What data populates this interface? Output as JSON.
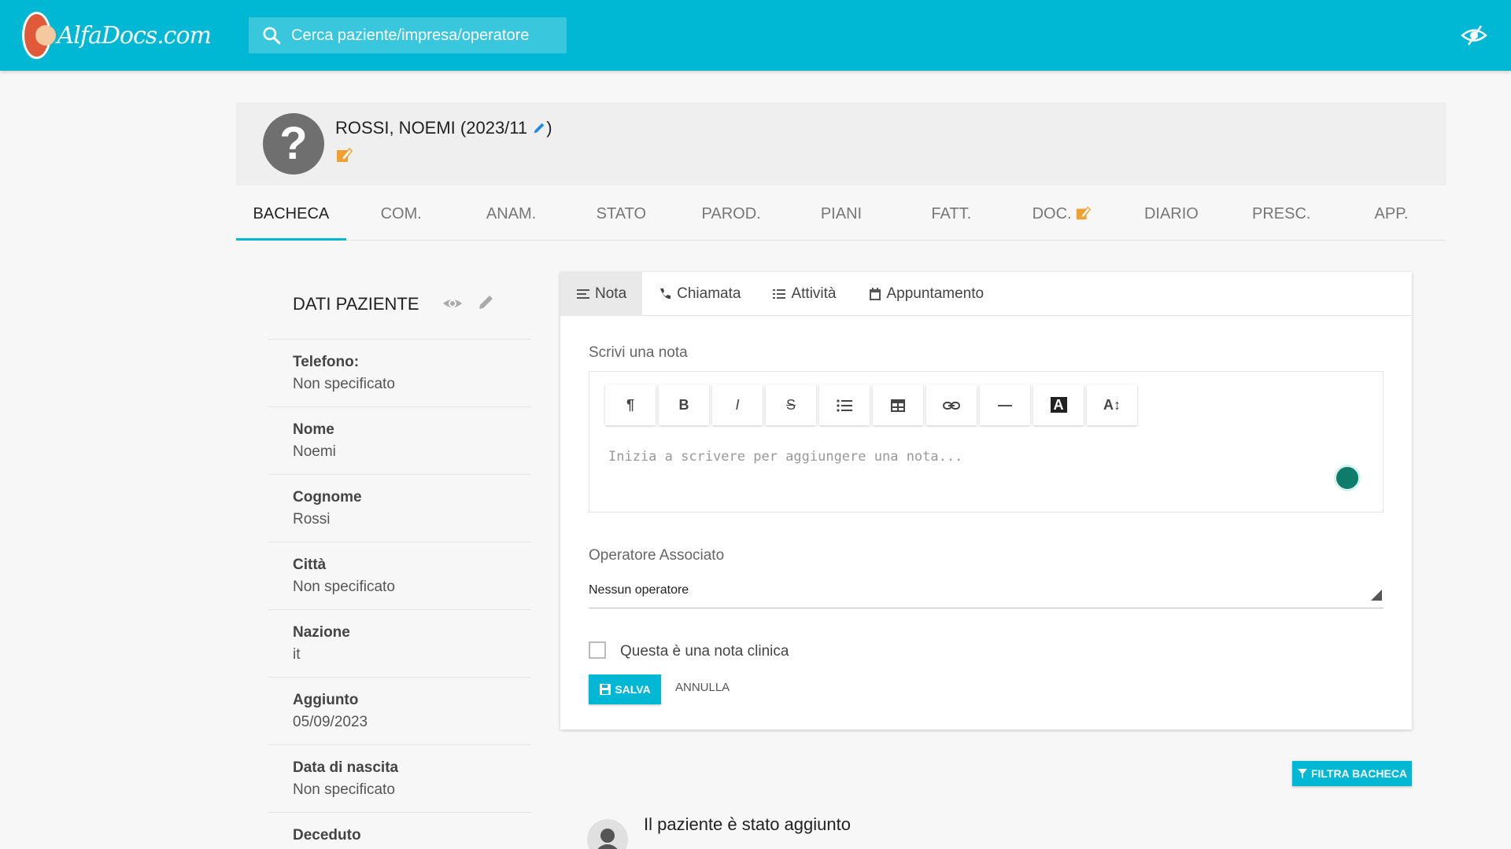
{
  "app": {
    "logo_text": "AlfaDocs.com",
    "search_placeholder": "Cerca paziente/impresa/operatore"
  },
  "patient": {
    "name": "ROSSI, NOEMI (2023/11",
    "name_suffix": ")",
    "avatar_glyph": "?"
  },
  "tabs": [
    {
      "label": "BACHECA",
      "active": true
    },
    {
      "label": "COM."
    },
    {
      "label": "ANAM."
    },
    {
      "label": "STATO"
    },
    {
      "label": "PAROD."
    },
    {
      "label": "PIANI"
    },
    {
      "label": "FATT."
    },
    {
      "label": "DOC."
    },
    {
      "label": "DIARIO"
    },
    {
      "label": "PRESC."
    },
    {
      "label": "APP."
    }
  ],
  "patient_data": {
    "title": "DATI PAZIENTE",
    "fields": [
      {
        "label": "Telefono:",
        "value": "Non specificato"
      },
      {
        "label": "Nome",
        "value": "Noemi"
      },
      {
        "label": "Cognome",
        "value": "Rossi"
      },
      {
        "label": "Città",
        "value": "Non specificato"
      },
      {
        "label": "Nazione",
        "value": "it"
      },
      {
        "label": "Aggiunto",
        "value": "05/09/2023"
      },
      {
        "label": "Data di nascita",
        "value": "Non specificato"
      },
      {
        "label": "Deceduto",
        "value": ""
      }
    ]
  },
  "note_card": {
    "tabs": [
      {
        "label": "Nota",
        "icon": "lines-icon",
        "active": true
      },
      {
        "label": "Chiamata",
        "icon": "phone-icon"
      },
      {
        "label": "Attività",
        "icon": "checklist-icon"
      },
      {
        "label": "Appuntamento",
        "icon": "calendar-icon"
      }
    ],
    "write_label": "Scrivi una nota",
    "toolbar": [
      {
        "glyph": "¶",
        "name": "paragraph"
      },
      {
        "glyph": "B",
        "name": "bold"
      },
      {
        "glyph": "I",
        "name": "italic"
      },
      {
        "glyph": "S",
        "name": "strikethrough"
      },
      {
        "glyph": "",
        "name": "bullet-list"
      },
      {
        "glyph": "",
        "name": "table"
      },
      {
        "glyph": "",
        "name": "link"
      },
      {
        "glyph": "—",
        "name": "horizontal-rule"
      },
      {
        "glyph": "A",
        "name": "text-color"
      },
      {
        "glyph": "A↕",
        "name": "font-size"
      }
    ],
    "editor_placeholder": "Inizia a scrivere per aggiungere una nota...",
    "operator_label": "Operatore Associato",
    "operator_value": "Nessun operatore",
    "clinical_label": "Questa è una nota clinica",
    "clinical_checked": false,
    "save_label": "SALVA",
    "cancel_label": "ANNULLA"
  },
  "board": {
    "filter_label": "FILTRA BACHECA",
    "activity_title": "Il paziente è stato aggiunto"
  },
  "colors": {
    "accent": "#00b8d4",
    "edit_orange": "#f0a030"
  }
}
